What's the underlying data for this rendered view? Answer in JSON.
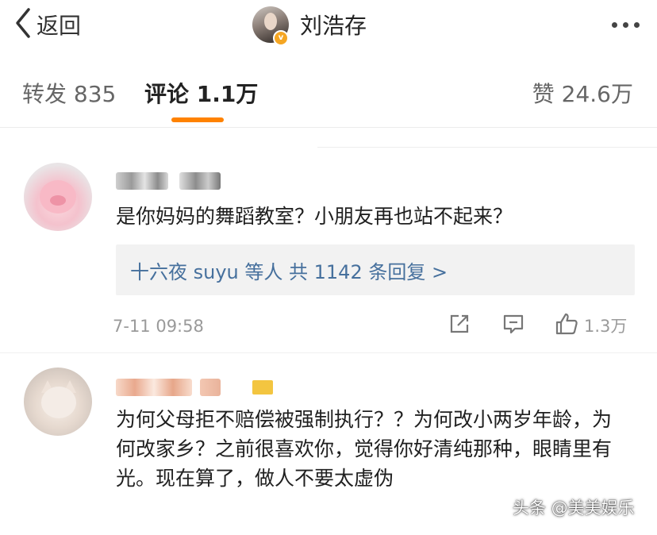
{
  "nav": {
    "back_label": "返回",
    "title": "刘浩存",
    "verified_badge": "v"
  },
  "tabs": {
    "repost": "转发 835",
    "comment": "评论 1.1万",
    "like": "赞 24.6万"
  },
  "colors": {
    "accent": "#ff8200",
    "link": "#46709d",
    "muted": "#9a9a9a"
  },
  "comments": [
    {
      "text": "是你妈妈的舞蹈教室？小朋友再也站不起来？",
      "reply_summary": "十六夜 suyu 等人  共 1142 条回复 >",
      "time": "7-11 09:58",
      "likes": "1.3万"
    },
    {
      "text": "为何父母拒不赔偿被强制执行？？为何改小两岁年龄，为何改家乡？之前很喜欢你，觉得你好清纯那种，眼睛里有光。现在算了，做人不要太虚伪"
    }
  ],
  "watermark": "头条 @美美娱乐",
  "icons": [
    "back-chevron-icon",
    "more-icon",
    "share-icon",
    "comment-icon",
    "like-icon"
  ]
}
